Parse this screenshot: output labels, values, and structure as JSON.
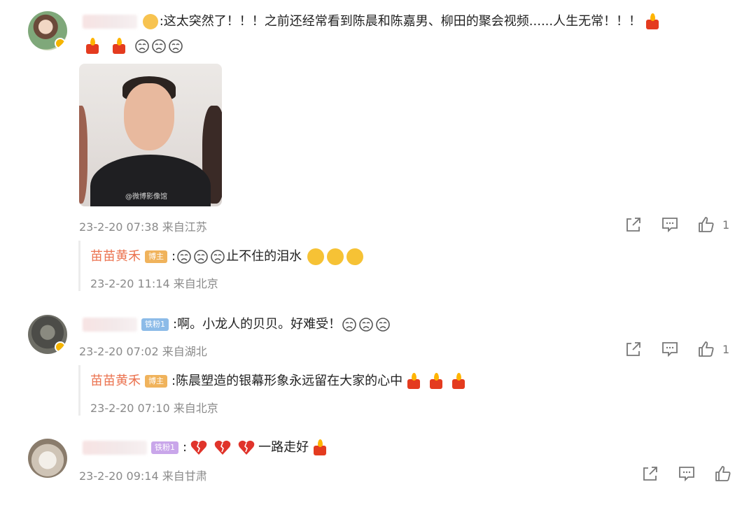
{
  "comments": [
    {
      "text": ":这太突然了！！！之前还经常看到陈晨和陈嘉男、柳田的聚会视频......人生无常！！！",
      "photo_watermark": "@微博影像馆",
      "time": "23-2-20 07:38 来自江苏",
      "likes": "1",
      "reply": {
        "name": "苗苗黄禾",
        "tag": "博主",
        "text": "止不住的泪水",
        "time": "23-2-20 11:14 来自北京"
      }
    },
    {
      "tag": "铁粉1",
      "text": ":啊。小龙人的贝贝。好难受！",
      "time": "23-2-20 07:02 来自湖北",
      "likes": "1",
      "reply": {
        "name": "苗苗黄禾",
        "tag": "博主",
        "text": ":陈晨塑造的银幕形象永远留在大家的心中",
        "time": "23-2-20 07:10 来自北京"
      }
    },
    {
      "tag": "铁粉1",
      "text": "一路走好",
      "time": "23-2-20 09:14 来自甘肃"
    }
  ],
  "colors": {
    "reply_name": "#eb7350",
    "meta": "#8a8a8a",
    "host_tag": "#f0b35c"
  },
  "icons": [
    "share-icon",
    "comment-icon",
    "like-icon",
    "candle-emoji",
    "crying-emoji",
    "sobbing-emoji",
    "broken-heart-emoji"
  ]
}
